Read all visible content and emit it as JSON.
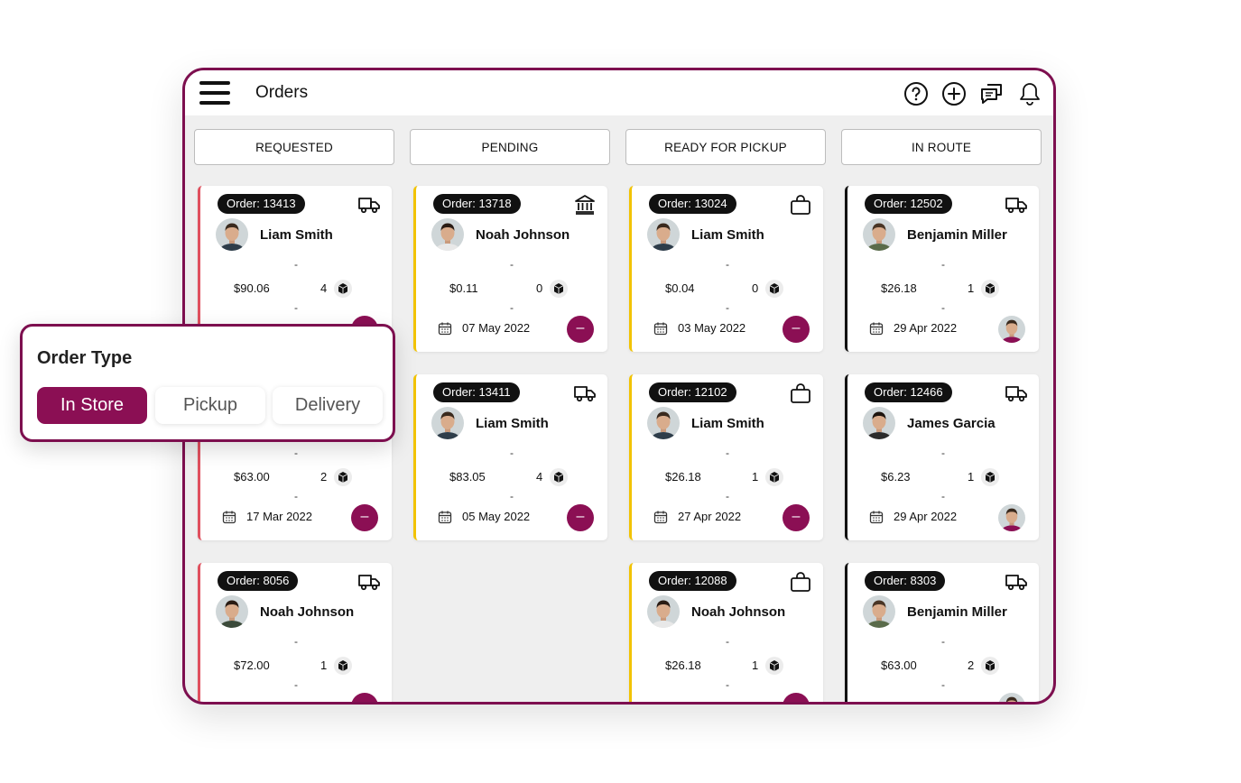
{
  "header": {
    "title": "Orders"
  },
  "columns": [
    {
      "label": "REQUESTED"
    },
    {
      "label": "PENDING"
    },
    {
      "label": "READY FOR PICKUP"
    },
    {
      "label": "IN ROUTE"
    }
  ],
  "cards": [
    {
      "order": "Order: 13413",
      "name": "Liam Smith",
      "price": "$90.06",
      "qty": "4",
      "date": "",
      "type_icon": "truck-icon",
      "accent": "red",
      "action": "minus"
    },
    {
      "order": "",
      "name": "",
      "price": "$63.00",
      "qty": "2",
      "date": "17 Mar 2022",
      "type_icon": "",
      "accent": "red",
      "action": "minus"
    },
    {
      "order": "Order: 8056",
      "name": "Noah Johnson",
      "price": "$72.00",
      "qty": "1",
      "date": "",
      "type_icon": "truck-icon",
      "accent": "red",
      "action": "minus"
    },
    {
      "order": "Order: 13718",
      "name": "Noah Johnson",
      "price": "$0.11",
      "qty": "0",
      "date": "07 May 2022",
      "type_icon": "bank-icon",
      "accent": "yellow",
      "action": "minus"
    },
    {
      "order": "Order: 13411",
      "name": "Liam Smith",
      "price": "$83.05",
      "qty": "4",
      "date": "05 May 2022",
      "type_icon": "truck-icon",
      "accent": "yellow",
      "action": "minus"
    },
    {
      "order": "Order: 13024",
      "name": "Liam Smith",
      "price": "$0.04",
      "qty": "0",
      "date": "03 May 2022",
      "type_icon": "bag-icon",
      "accent": "yellow",
      "action": "minus"
    },
    {
      "order": "Order: 12102",
      "name": "Liam Smith",
      "price": "$26.18",
      "qty": "1",
      "date": "27 Apr 2022",
      "type_icon": "bag-icon",
      "accent": "yellow",
      "action": "minus"
    },
    {
      "order": "Order: 12088",
      "name": "Noah Johnson",
      "price": "$26.18",
      "qty": "1",
      "date": "",
      "type_icon": "bag-icon",
      "accent": "yellow",
      "action": "minus"
    },
    {
      "order": "Order: 12502",
      "name": "Benjamin Miller",
      "price": "$26.18",
      "qty": "1",
      "date": "29 Apr 2022",
      "type_icon": "truck-icon",
      "accent": "black",
      "action": "assignee"
    },
    {
      "order": "Order: 12466",
      "name": "James Garcia",
      "price": "$6.23",
      "qty": "1",
      "date": "29 Apr 2022",
      "type_icon": "truck-icon",
      "accent": "black",
      "action": "assignee"
    },
    {
      "order": "Order: 8303",
      "name": "Benjamin Miller",
      "price": "$63.00",
      "qty": "2",
      "date": "",
      "type_icon": "truck-icon",
      "accent": "black",
      "action": "assignee"
    }
  ],
  "popup": {
    "title": "Order Type",
    "options": [
      {
        "label": "In Store",
        "active": true
      },
      {
        "label": "Pickup",
        "active": false
      },
      {
        "label": "Delivery",
        "active": false
      }
    ]
  },
  "colors": {
    "brand": "#8b0f54",
    "frame": "#7d0f4f",
    "requested": "#e0505e",
    "pending": "#f2c300",
    "in_route": "#111111"
  },
  "separator": "-"
}
